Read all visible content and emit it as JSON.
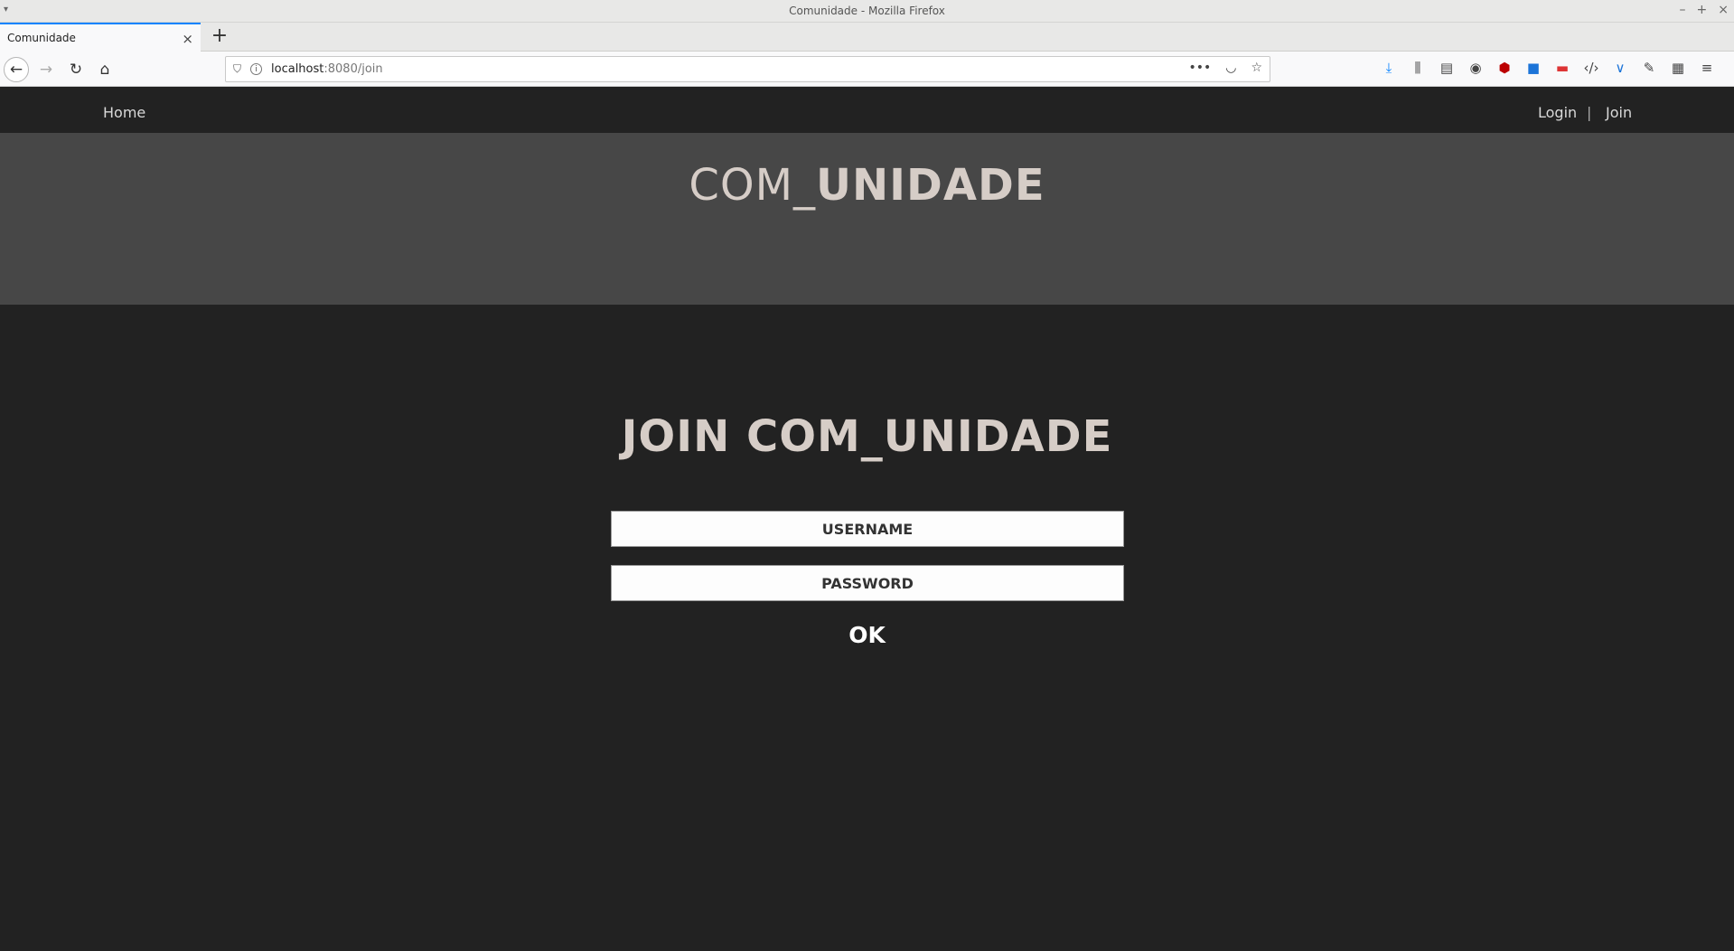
{
  "window": {
    "title": "Comunidade - Mozilla Firefox",
    "controls": {
      "minimize": "–",
      "maximize": "+",
      "close": "×"
    }
  },
  "tabs": [
    {
      "label": "Comunidade",
      "active": true
    }
  ],
  "toolbar": {
    "url_host": "localhost",
    "url_path": ":8080/join"
  },
  "site_nav": {
    "home": "Home",
    "login": "Login",
    "separator": "|",
    "join": "Join"
  },
  "hero": {
    "brand_light": "COM_",
    "brand_bold": "UNIDADE"
  },
  "join_form": {
    "title_bold": "JOIN",
    "title_light": " COM_",
    "title_bold2": "UNIDADE",
    "username_placeholder": "USERNAME",
    "password_placeholder": "PASSWORD",
    "submit_label": "OK"
  },
  "colors": {
    "page_bg": "#222222",
    "hero_bg": "#474747",
    "title_text": "#d6cdc7",
    "nav_text": "#d9d9d9",
    "firefox_accent": "#0a84ff"
  }
}
